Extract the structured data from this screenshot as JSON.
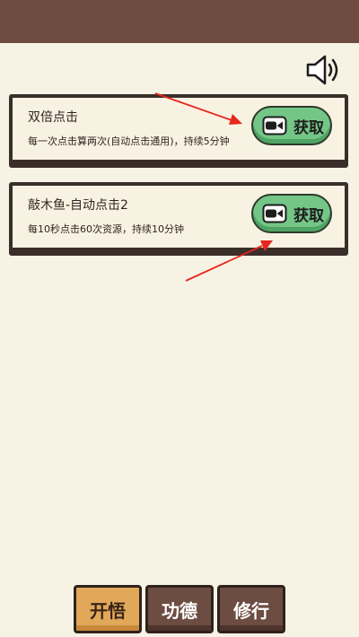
{
  "header": {
    "bg_color": "#6e4c40",
    "sound_icon": "speaker-volume-icon"
  },
  "rewards": [
    {
      "title": "双倍点击",
      "description": "每一次点击算两次(自动点击通用)，持续5分钟",
      "button_label": "获取",
      "button_icon": "video-camera-icon"
    },
    {
      "title": "敲木鱼-自动点击2",
      "description": "每10秒点击60次资源，持续10分钟",
      "button_label": "获取",
      "button_icon": "video-camera-icon"
    }
  ],
  "tabs": [
    {
      "label": "开悟",
      "active": true
    },
    {
      "label": "功德",
      "active": false
    },
    {
      "label": "修行",
      "active": false
    }
  ],
  "colors": {
    "background": "#f7f3e4",
    "button_green": "#74c687",
    "tab_active": "#e2a85a",
    "tab_inactive": "#6d4c41",
    "annotation_arrow": "#e8261c"
  }
}
